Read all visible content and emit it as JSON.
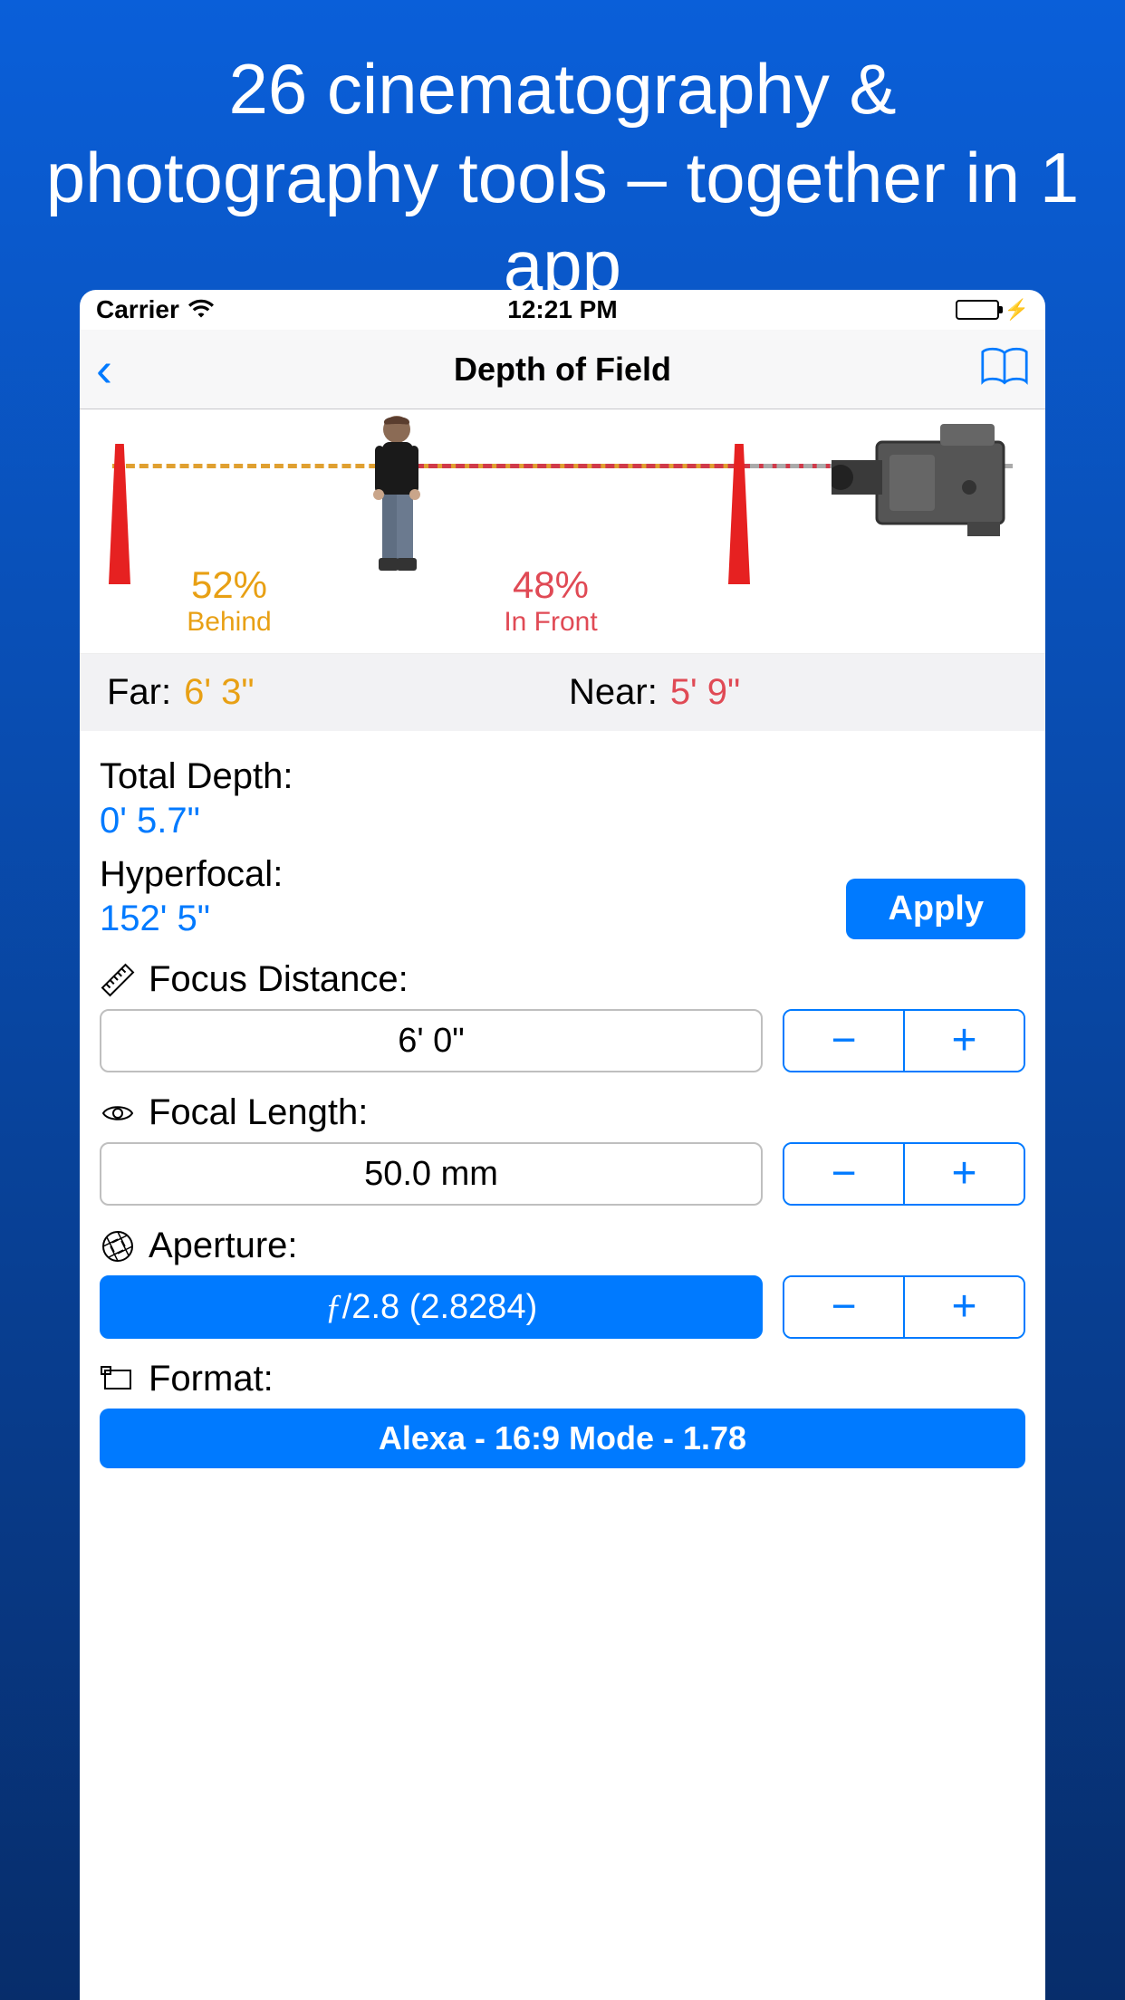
{
  "promo": "26 cinematography & photography tools – together in 1 app",
  "status": {
    "carrier": "Carrier",
    "time": "12:21 PM"
  },
  "nav": {
    "title": "Depth of Field"
  },
  "viz": {
    "behind_pct": "52%",
    "behind_label": "Behind",
    "front_pct": "48%",
    "front_label": "In Front"
  },
  "near_far": {
    "far_label": "Far:",
    "far_value": "6' 3\"",
    "near_label": "Near:",
    "near_value": "5' 9\""
  },
  "total_depth": {
    "label": "Total Depth:",
    "value": "0' 5.7\""
  },
  "hyperfocal": {
    "label": "Hyperfocal:",
    "value": "152' 5\"",
    "apply": "Apply"
  },
  "focus_distance": {
    "label": "Focus Distance:",
    "value": "6' 0\""
  },
  "focal_length": {
    "label": "Focal Length:",
    "value": "50.0 mm"
  },
  "aperture": {
    "label": "Aperture:",
    "f": "ƒ",
    "value": "/2.8 (2.8284)"
  },
  "format": {
    "label": "Format:",
    "value": "Alexa - 16:9 Mode - 1.78"
  }
}
